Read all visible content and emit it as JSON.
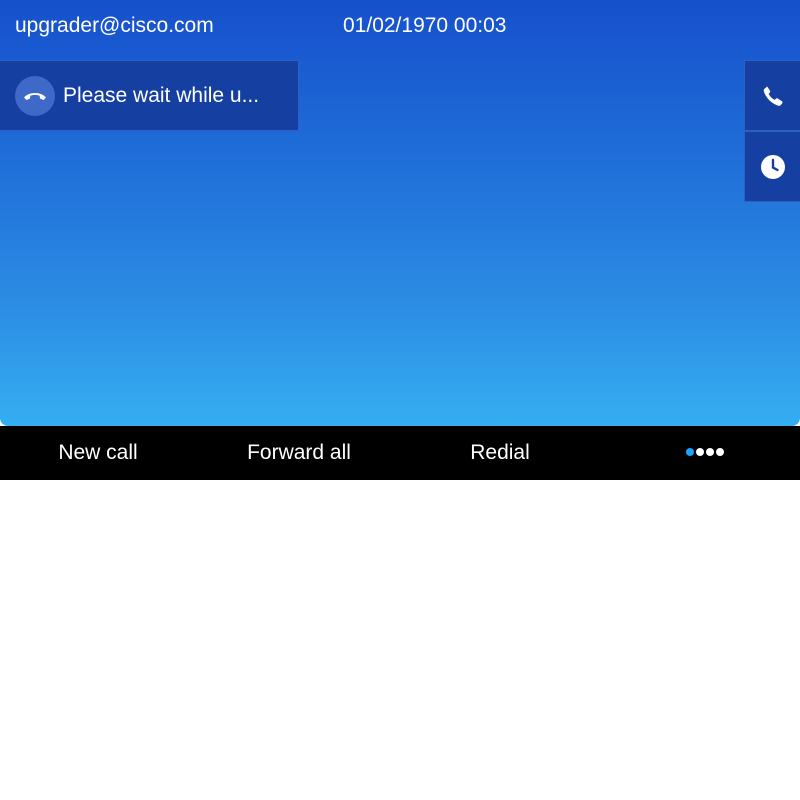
{
  "status_bar": {
    "user": "upgrader@cisco.com",
    "datetime": "01/02/1970 00:03"
  },
  "session": {
    "icon": "hangup-icon",
    "label": "Please wait while u..."
  },
  "side_buttons": [
    {
      "icon": "phone-icon"
    },
    {
      "icon": "clock-icon"
    }
  ],
  "softkeys": [
    {
      "label": "New call"
    },
    {
      "label": "Forward all"
    },
    {
      "label": "Redial"
    }
  ],
  "more": {
    "icon": "more-dots-icon",
    "pages": 4,
    "active_page": 1
  },
  "colors": {
    "background_top": "#1650cc",
    "background_bottom": "#35aef2",
    "softkey_bar": "#000000",
    "active_dot": "#1aa3ff"
  }
}
